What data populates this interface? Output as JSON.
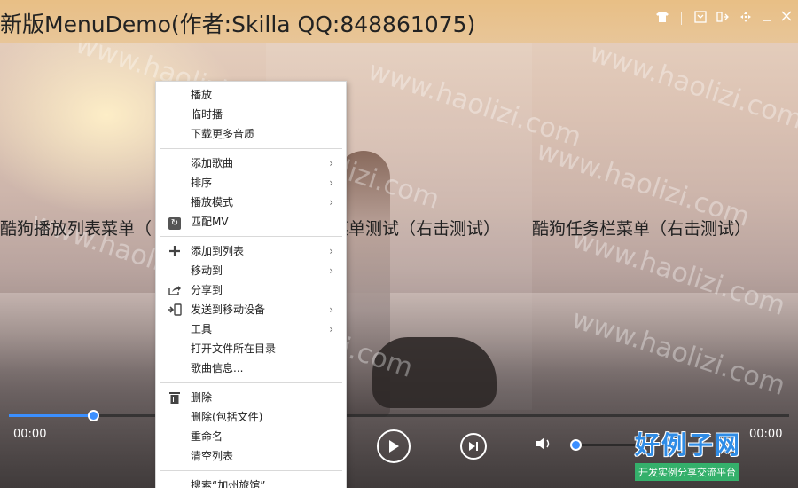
{
  "window": {
    "title": "新版MenuDemo(作者:Skilla QQ:848861075)"
  },
  "labels": {
    "left": "酷狗播放列表菜单（",
    "middle": "菜单测试（右击测试）",
    "right": "酷狗任务栏菜单（右击测试）"
  },
  "watermark": "www.haolizi.com",
  "menu": {
    "group1": [
      "播放",
      "临时播",
      "下载更多音质"
    ],
    "group2": [
      {
        "label": "添加歌曲",
        "submenu": true
      },
      {
        "label": "排序",
        "submenu": true
      },
      {
        "label": "播放模式",
        "submenu": true
      },
      {
        "label": "匹配MV",
        "icon": "mv-icon"
      }
    ],
    "group3": [
      {
        "label": "添加到列表",
        "submenu": true,
        "icon": "plus-icon"
      },
      {
        "label": "移动到",
        "submenu": true
      },
      {
        "label": "分享到",
        "icon": "share-icon"
      },
      {
        "label": "发送到移动设备",
        "submenu": true,
        "icon": "send-device-icon"
      },
      {
        "label": "工具",
        "submenu": true
      },
      {
        "label": "打开文件所在目录"
      },
      {
        "label": "歌曲信息..."
      }
    ],
    "group4": [
      {
        "label": "删除",
        "icon": "trash-icon"
      },
      {
        "label": "删除(包括文件)"
      },
      {
        "label": "重命名"
      },
      {
        "label": "清空列表"
      }
    ],
    "group5": [
      "搜索“加州旅馆”"
    ]
  },
  "player": {
    "current_time": "00:00",
    "total_time": "00:00",
    "progress_fraction": 0.108,
    "volume_fraction": 0.0
  },
  "logo": {
    "main": "好例子网",
    "sub": "开发实例分享交流平台"
  },
  "colors": {
    "accent": "#3b8fff",
    "titlebar": "#e8bd80",
    "logo_green": "#34b06b",
    "logo_blue": "#2f8ce6"
  }
}
